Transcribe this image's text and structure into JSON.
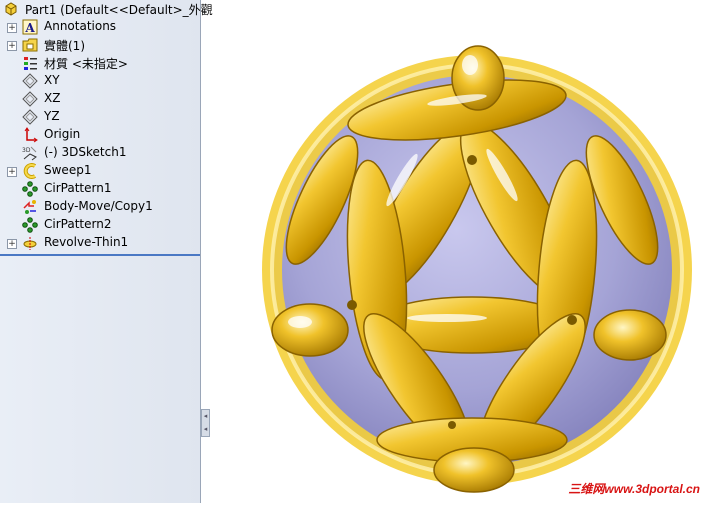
{
  "feature_tree": {
    "root_label": "Part1  (Default<<Default>_外觀",
    "items": [
      {
        "label": "Annotations",
        "icon": "annotations-icon",
        "expandable": true
      },
      {
        "label": "實體(1)",
        "icon": "solid-bodies-icon",
        "expandable": true
      },
      {
        "label": "材質 <未指定>",
        "icon": "material-icon",
        "expandable": false
      },
      {
        "label": "XY",
        "icon": "plane-icon",
        "expandable": false
      },
      {
        "label": "XZ",
        "icon": "plane-icon",
        "expandable": false
      },
      {
        "label": "YZ",
        "icon": "plane-icon",
        "expandable": false
      },
      {
        "label": "Origin",
        "icon": "origin-icon",
        "expandable": false
      },
      {
        "label": "(-) 3DSketch1",
        "icon": "3d-sketch-icon",
        "expandable": false
      },
      {
        "label": "Sweep1",
        "icon": "sweep-icon",
        "expandable": true
      },
      {
        "label": "CirPattern1",
        "icon": "circular-pattern-icon",
        "expandable": false
      },
      {
        "label": "Body-Move/Copy1",
        "icon": "move-copy-icon",
        "expandable": false
      },
      {
        "label": "CirPattern2",
        "icon": "circular-pattern-icon",
        "expandable": false
      },
      {
        "label": "Revolve-Thin1",
        "icon": "revolve-icon",
        "expandable": true
      }
    ]
  },
  "watermark": "三维网www.3dportal.cn",
  "colors": {
    "gold": "#e8b820",
    "sphere": "#a9a8d8",
    "accent": "#4a78c4"
  }
}
